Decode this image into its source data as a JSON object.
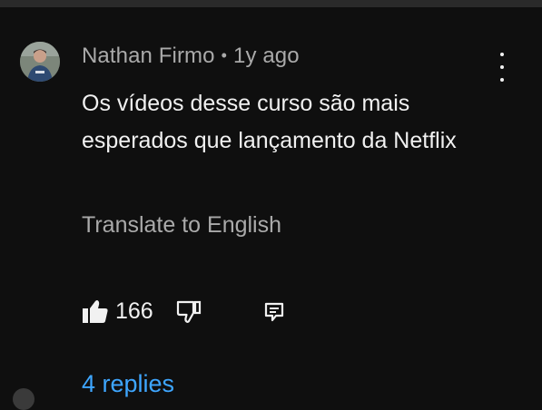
{
  "comment": {
    "author": "Nathan Firmo",
    "separator": "•",
    "time_ago": "1y ago",
    "text": "Os vídeos desse curso são mais esperados que lançamento da Netflix",
    "translate_label": "Translate to English",
    "like_count": "166",
    "replies_label": "4 replies"
  },
  "icons": {
    "like": "thumbs-up-icon",
    "dislike": "thumbs-down-icon",
    "reply": "comment-reply-icon",
    "more": "more-vertical-icon"
  },
  "colors": {
    "background": "#0f0f0f",
    "primary_text": "#f1f1f1",
    "secondary_text": "#aaaaaa",
    "link": "#3ea6ff"
  }
}
